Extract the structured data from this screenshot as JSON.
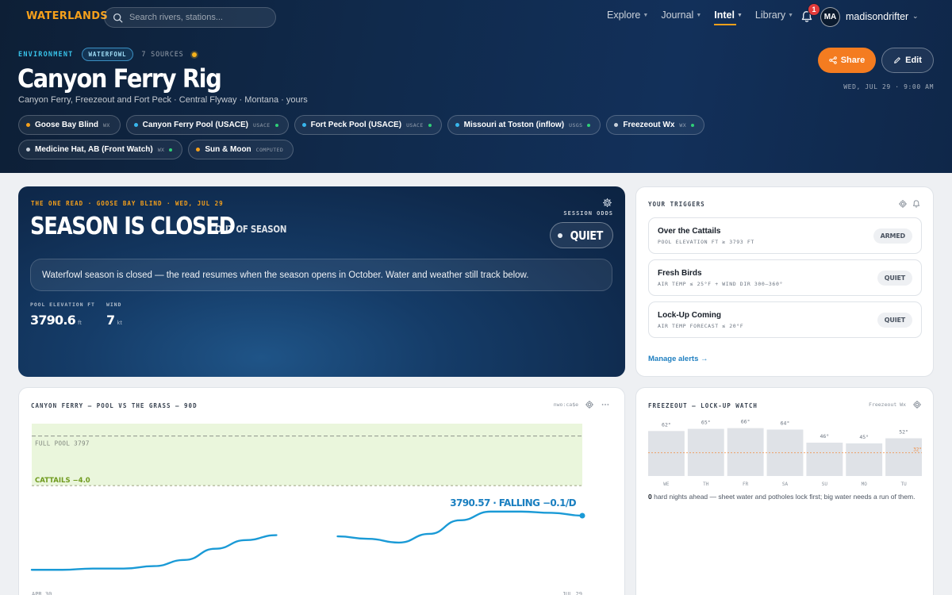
{
  "app": {
    "logo": "WATERLANDS"
  },
  "search": {
    "placeholder": "Search rivers, stations..."
  },
  "nav": [
    {
      "label": "Explore",
      "active": false
    },
    {
      "label": "Journal",
      "active": false
    },
    {
      "label": "Intel",
      "active": true
    },
    {
      "label": "Library",
      "active": false
    }
  ],
  "notifications": {
    "count": "1"
  },
  "user": {
    "initials": "MA",
    "name": "madisondrifter"
  },
  "header": {
    "eyebrow": "ENVIRONMENT",
    "tag": "WATERFOWL",
    "sources": "7 SOURCES",
    "title": "Canyon Ferry Rig",
    "subtitle": "Canyon Ferry, Freezeout and Fort Peck · Central Flyway · Montana · yours",
    "share_label": "Share",
    "edit_label": "Edit",
    "timestamp": "WED, JUL 29 · 9:00 AM"
  },
  "chips": [
    {
      "name": "Goose Bay Blind",
      "src": "WX",
      "dot": "#f5a01b",
      "status": false
    },
    {
      "name": "Canyon Ferry Pool (USACE)",
      "src": "USACE",
      "dot": "#38b6ec",
      "status": true
    },
    {
      "name": "Fort Peck Pool (USACE)",
      "src": "USACE",
      "dot": "#38b6ec",
      "status": true
    },
    {
      "name": "Missouri at Toston (inflow)",
      "src": "USGS",
      "dot": "#38b6ec",
      "status": true
    },
    {
      "name": "Freezeout Wx",
      "src": "WX",
      "dot": "#c8d0da",
      "status": true
    },
    {
      "name": "Medicine Hat, AB (Front Watch)",
      "src": "WX",
      "dot": "#c8d0da",
      "status": true
    },
    {
      "name": "Sun & Moon",
      "src": "COMPUTED",
      "dot": "#f5a01b",
      "status": false
    }
  ],
  "read": {
    "eyebrow": "THE ONE READ · GOOSE BAY BLIND · WED, JUL 29",
    "title": "SEASON IS CLOSED",
    "subtag": "OUT OF SEASON",
    "odds_label": "SESSION ODDS",
    "odds_value": "QUIET",
    "message": "Waterfowl season is closed — the read resumes when the season opens in October. Water and weather still track below.",
    "stats": [
      {
        "label": "POOL ELEVATION FT",
        "value": "3790.6",
        "unit": "ft"
      },
      {
        "label": "WIND",
        "value": "7",
        "unit": "kt"
      }
    ]
  },
  "triggers": {
    "heading": "YOUR TRIGGERS",
    "items": [
      {
        "name": "Over the Cattails",
        "cond": "POOL ELEVATION FT ≥ 3793 FT",
        "status": "ARMED"
      },
      {
        "name": "Fresh Birds",
        "cond": "AIR TEMP ≤ 25°F + WIND DIR 300–360°",
        "status": "QUIET"
      },
      {
        "name": "Lock-Up Coming",
        "cond": "AIR TEMP FORECAST ≤ 20°F",
        "status": "QUIET"
      }
    ],
    "manage": "Manage alerts →"
  },
  "pool_chart": {
    "heading": "CANYON FERRY — POOL VS THE GRASS — 90D",
    "source": "nwo:ca$e",
    "full_pool_label": "FULL POOL 3797",
    "cattails_label": "CATTAILS −4.0",
    "current_label": "3790.57 · FALLING −0.1/D",
    "x_start": "APR 30",
    "x_end": "JUL 29",
    "line_color": "#1a9ad6",
    "band_color": "#eaf6dc"
  },
  "freezeout": {
    "heading": "FREEZEOUT — LOCK-UP WATCH",
    "source": "Freezeout Wx",
    "threshold_label": "32°",
    "note_count": "0",
    "note_text": " hard nights ahead — sheet water and potholes lock first; big water needs a run of them."
  },
  "chart_data": [
    {
      "type": "line",
      "title": "CANYON FERRY — POOL VS THE GRASS — 90D",
      "x": [
        0,
        5,
        10,
        15,
        20,
        25,
        30,
        35,
        40,
        45,
        50,
        55,
        60,
        65,
        70,
        75,
        80,
        85,
        90
      ],
      "series": [
        {
          "values": [
            3786.2,
            3786.2,
            3786.3,
            3786.3,
            3786.5,
            3787.0,
            3787.9,
            3788.6,
            3789.0,
            null,
            3788.9,
            3788.7,
            3788.4,
            3789.1,
            3790.2,
            3790.9,
            3790.9,
            3790.8,
            3790.57
          ]
        }
      ],
      "x_tick_labels": [
        "APR 30",
        "JUL 29"
      ],
      "reference_lines": [
        {
          "label": "FULL POOL 3797",
          "value": 3797
        },
        {
          "label": "CATTAILS −4.0",
          "value": 3793
        }
      ],
      "ylim": [
        3785,
        3798
      ],
      "annotation": "3790.57 · FALLING −0.1/D"
    },
    {
      "type": "bar",
      "title": "FREEZEOUT — LOCK-UP WATCH",
      "categories": [
        "WE",
        "TH",
        "FR",
        "SA",
        "SU",
        "MO",
        "TU"
      ],
      "values": [
        62,
        65,
        66,
        64,
        46,
        45,
        52
      ],
      "value_labels": [
        "62°",
        "65°",
        "66°",
        "64°",
        "46°",
        "45°",
        "52°"
      ],
      "threshold": {
        "label": "32°",
        "value": 32
      },
      "ylim": [
        0,
        70
      ]
    }
  ]
}
